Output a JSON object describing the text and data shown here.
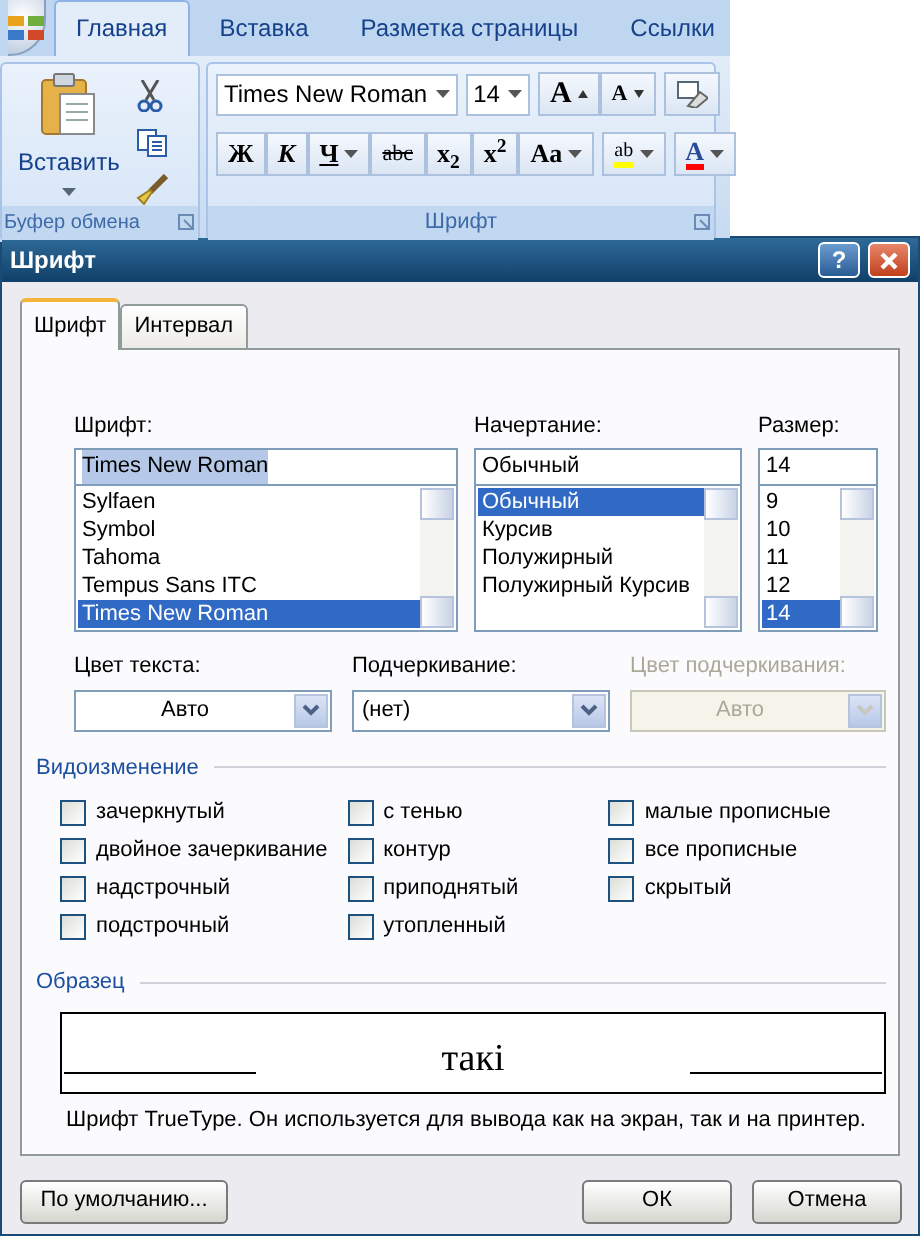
{
  "ribbon": {
    "tabs": [
      {
        "label": "Главная",
        "selected": true
      },
      {
        "label": "Вставка",
        "selected": false
      },
      {
        "label": "Разметка страницы",
        "selected": false
      },
      {
        "label": "Ссылки",
        "selected": false
      }
    ],
    "clipboard": {
      "paste_label": "Вставить",
      "group_label": "Буфер обмена"
    },
    "font_group": {
      "font_name": "Times New Roman",
      "font_size": "14",
      "grow_label": "A",
      "shrink_label": "A",
      "group_label": "Шрифт",
      "format_buttons": [
        {
          "kind": "bold",
          "label": "Ж"
        },
        {
          "kind": "italic",
          "label": "К"
        },
        {
          "kind": "underline",
          "label": "Ч"
        },
        {
          "kind": "strike",
          "label": "abc"
        },
        {
          "kind": "sub",
          "label": "x$_{2}$"
        },
        {
          "kind": "sup",
          "label": "x$^{2}$"
        },
        {
          "kind": "case",
          "label": "Aa"
        }
      ],
      "highlight_label": "ab",
      "font_color_label": "A"
    }
  },
  "dialog": {
    "title": "Шрифт",
    "help": "?",
    "tabs": [
      {
        "label": "Шрифт",
        "selected": true
      },
      {
        "label": "Интервал",
        "selected": false
      }
    ],
    "font": {
      "label": "Шрифт:",
      "value": "Times New Roman",
      "items": [
        {
          "label": "Sylfaen",
          "selected": false
        },
        {
          "label": "Symbol",
          "selected": false
        },
        {
          "label": "Tahoma",
          "selected": false
        },
        {
          "label": "Tempus Sans ITC",
          "selected": false
        },
        {
          "label": "Times New Roman",
          "selected": true
        }
      ]
    },
    "style": {
      "label": "Начертание:",
      "value": "Обычный",
      "items": [
        {
          "label": "Обычный",
          "selected": true
        },
        {
          "label": "Курсив",
          "selected": false
        },
        {
          "label": "Полужирный",
          "selected": false
        },
        {
          "label": "Полужирный Курсив",
          "selected": false
        }
      ]
    },
    "size": {
      "label": "Размер:",
      "value": "14",
      "items": [
        {
          "label": "9",
          "selected": false
        },
        {
          "label": "10",
          "selected": false
        },
        {
          "label": "11",
          "selected": false
        },
        {
          "label": "12",
          "selected": false
        },
        {
          "label": "14",
          "selected": true
        }
      ]
    },
    "text_color": {
      "label": "Цвет текста:",
      "value": "Авто",
      "disabled": false
    },
    "underline": {
      "label": "Подчеркивание:",
      "value": "(нет)",
      "disabled": false
    },
    "underline_color": {
      "label": "Цвет подчеркивания:",
      "value": "Авто",
      "disabled": true
    },
    "effects": {
      "label": "Видоизменение",
      "columns": [
        [
          {
            "label": "зачеркнутый",
            "checked": false
          },
          {
            "label": "двойное зачеркивание",
            "checked": false
          },
          {
            "label": "надстрочный",
            "checked": false
          },
          {
            "label": "подстрочный",
            "checked": false
          }
        ],
        [
          {
            "label": "с тенью",
            "checked": false
          },
          {
            "label": "контур",
            "checked": false
          },
          {
            "label": "приподнятый",
            "checked": false
          },
          {
            "label": "утопленный",
            "checked": false
          }
        ],
        [
          {
            "label": "малые прописные",
            "checked": false
          },
          {
            "label": "все прописные",
            "checked": false
          },
          {
            "label": "скрытый",
            "checked": false
          }
        ]
      ]
    },
    "sample": {
      "label": "Образец",
      "text": "такі",
      "description": "Шрифт TrueType. Он используется для вывода как на экран, так и на принтер."
    },
    "buttons": [
      {
        "label": "По умолчанию...",
        "kind": "left"
      },
      {
        "label": "ОК",
        "kind": "right"
      },
      {
        "label": "Отмена",
        "kind": "right"
      }
    ]
  }
}
